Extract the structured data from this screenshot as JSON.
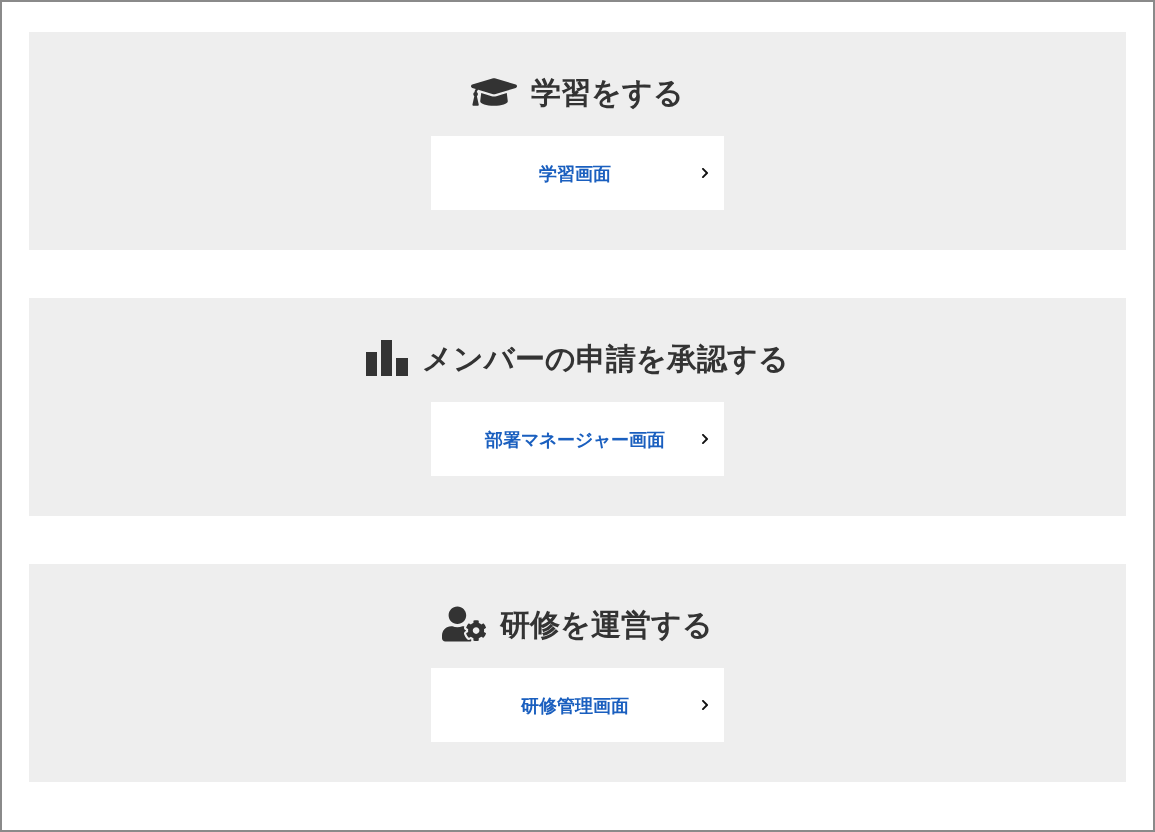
{
  "sections": [
    {
      "title": "学習をする",
      "button": "学習画面"
    },
    {
      "title": "メンバーの申請を承認する",
      "button": "部署マネージャー画面"
    },
    {
      "title": "研修を運営する",
      "button": "研修管理画面"
    }
  ]
}
